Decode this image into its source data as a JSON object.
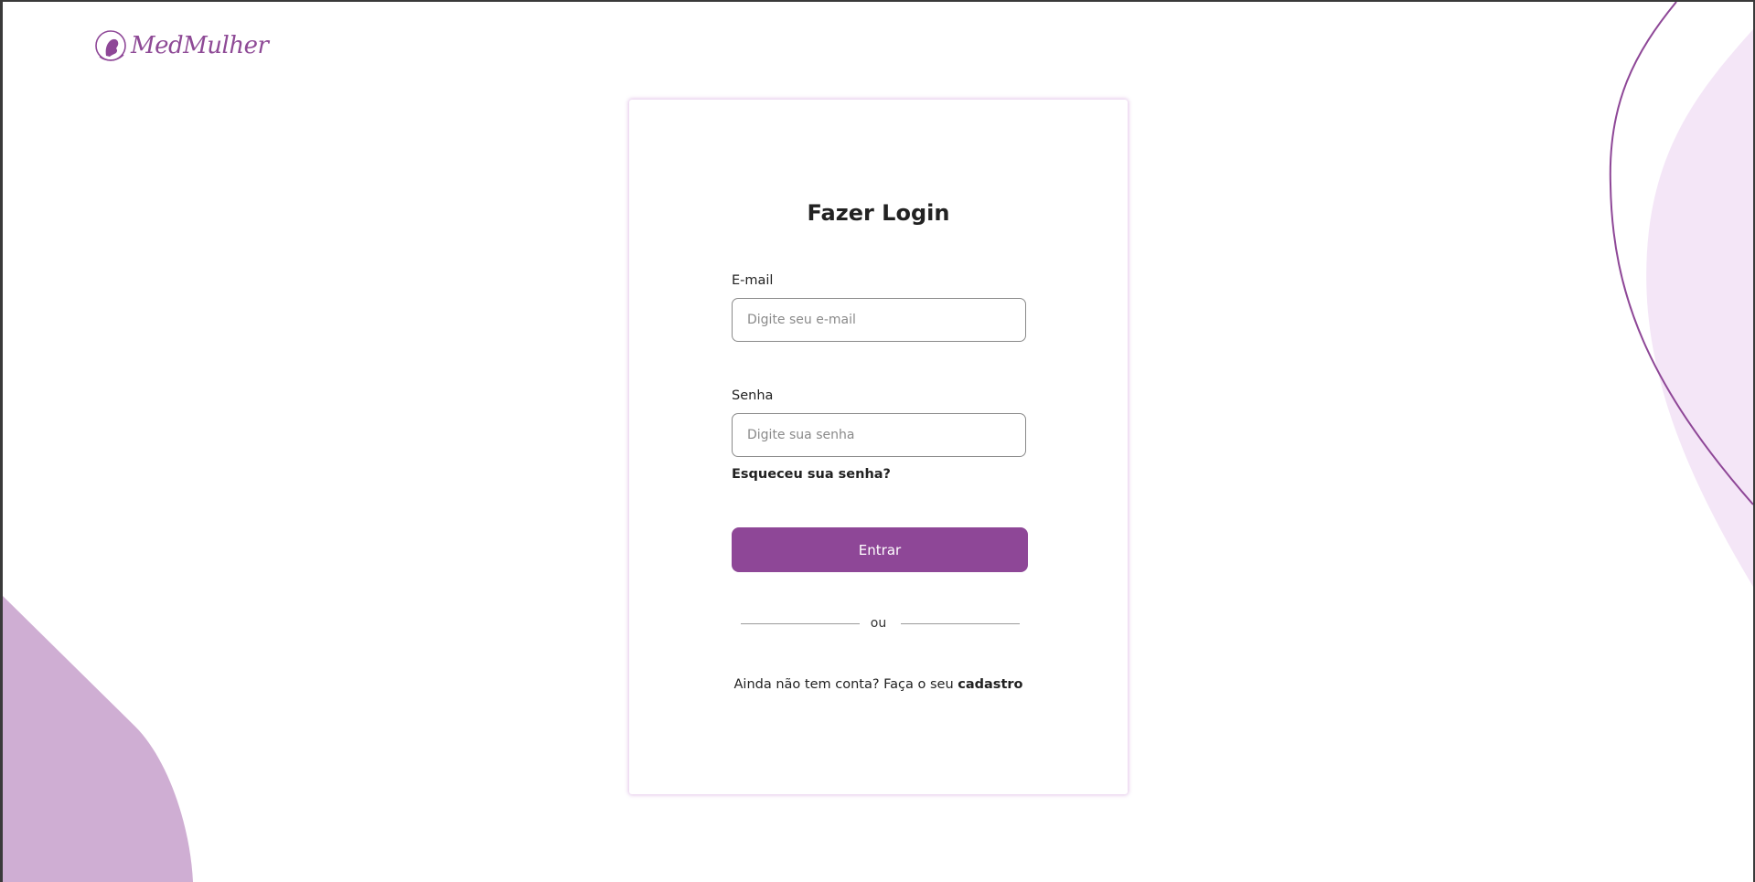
{
  "brand": {
    "name": "MedMulher",
    "color": "#8e4797",
    "light_color": "#f4e6f7",
    "decor_color": "#cfaed3",
    "logo_icon": "woman-profile-icon"
  },
  "login": {
    "title": "Fazer Login",
    "email": {
      "label": "E-mail",
      "placeholder": "Digite seu e-mail",
      "value": ""
    },
    "password": {
      "label": "Senha",
      "placeholder": "Digite sua senha",
      "value": ""
    },
    "forgot_link": "Esqueceu sua senha?",
    "submit_label": "Entrar",
    "divider": "ou",
    "signup_prompt": "Ainda não tem conta? Faça o seu",
    "signup_link": "cadastro"
  }
}
